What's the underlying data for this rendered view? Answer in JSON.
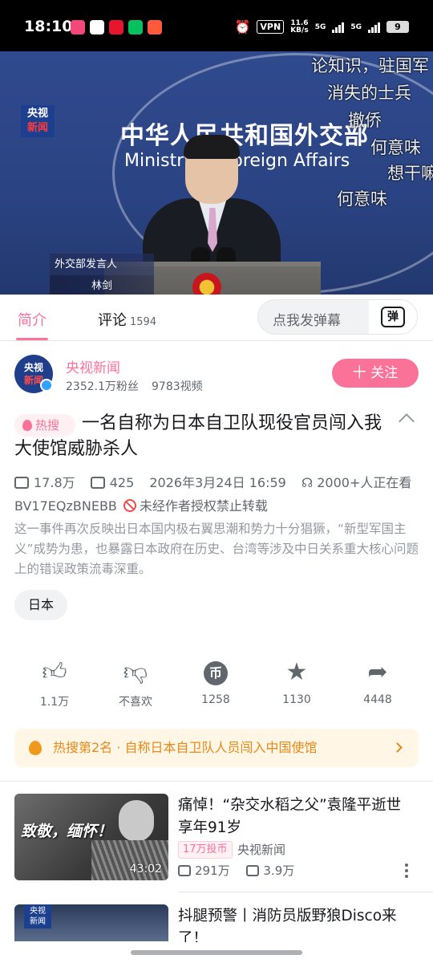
{
  "status_bar": {
    "time": "18:10",
    "vpn": "VPN",
    "net_speed": "11.6",
    "net_unit": "KB/s",
    "sig1": "5G",
    "sig2": "5G",
    "battery": "9",
    "app_icon_colors": [
      "#f5487a",
      "#ffffff",
      "#e6162d",
      "#07c160",
      "#ff5a3c"
    ]
  },
  "video": {
    "channel_logo_top": "央视",
    "channel_logo_bottom": "新闻",
    "wall_title": "中华人民共和国外交部",
    "wall_subtitle": "Ministry of Foreign Affairs",
    "caption_role": "外交部发言人",
    "caption_name": "林剑",
    "danmaku": [
      "论知识，驻国军",
      "消失的士兵",
      "撤侨",
      "何意味",
      "想干嘛",
      "何意味"
    ]
  },
  "tabs": {
    "intro": "简介",
    "comments": "评论",
    "comments_count": "1594",
    "danmaku_placeholder": "点我发弹幕",
    "danmaku_button": "弹"
  },
  "uploader": {
    "avatar_top": "央视",
    "avatar_bottom": "新闻",
    "name": "央视新闻",
    "followers": "2352.1万粉丝",
    "videos": "9783视频",
    "follow_button": "十 关注"
  },
  "video_info": {
    "hot_tag": "热搜",
    "title": "一名自称为日本自卫队现役官员闯入我大使馆威胁杀人",
    "views": "17.8万",
    "danmaku_count": "425",
    "datetime": "2026年3月24日 16:59",
    "watching": "2000+人正在看",
    "bvid": "BV17EQzBNEBB",
    "repost_notice": "未经作者授权禁止转载",
    "description": "这一事件再次反映出日本国内极右翼思潮和势力十分猖獗，“新型军国主义”成势为患，也暴露日本政府在历史、台湾等涉及中日关系重大核心问题上的错误政策流毒深重。",
    "tag": "日本"
  },
  "actions": {
    "like": "1.1万",
    "dislike": "不喜欢",
    "coin": "1258",
    "coin_glyph": "币",
    "favorite": "1130",
    "share": "4448"
  },
  "hot_banner": {
    "text": "热搜第2名 · 自称日本自卫队人员闯入中国使馆"
  },
  "related": [
    {
      "thumb_text": "致敬，缅怀！",
      "duration": "43:02",
      "title": "痛悼！“杂交水稻之父”袁隆平逝世 享年91岁",
      "coin_badge": "17万投币",
      "author": "央视新闻",
      "views": "291万",
      "danmaku": "3.9万"
    },
    {
      "thumb_logo_top": "央视",
      "thumb_logo_bottom": "新闻",
      "title": "抖腿预警丨消防员版野狼Disco来了！"
    }
  ],
  "colors": {
    "brand_pink": "#fb7299",
    "hot_orange": "#e88a1a",
    "video_blue": "#2f4a8e"
  }
}
